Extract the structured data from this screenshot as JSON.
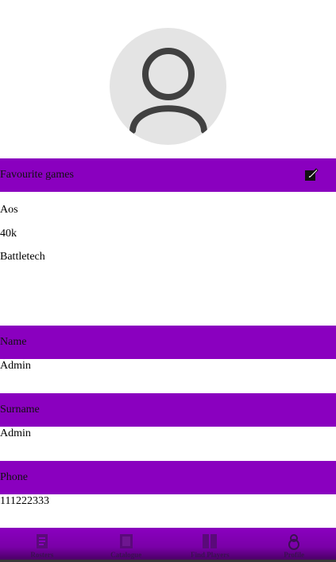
{
  "avatar": {
    "icon": "user-avatar-icon"
  },
  "favourites": {
    "header": "Favourite games",
    "edit_icon": "edit-icon",
    "games": [
      "Aos",
      "40k",
      "Battletech"
    ]
  },
  "fields": [
    {
      "label": "Name",
      "value": "Admin"
    },
    {
      "label": "Surname",
      "value": "Admin"
    },
    {
      "label": "Phone",
      "value": "111222333"
    }
  ],
  "nav": [
    {
      "label": "Rosters",
      "icon": "roster-icon"
    },
    {
      "label": "Catalogue",
      "icon": "catalogue-icon"
    },
    {
      "label": "Find Players",
      "icon": "book-icon"
    },
    {
      "label": "Profile",
      "icon": "profile-icon"
    }
  ],
  "colors": {
    "accent": "#8a00bf",
    "avatar_bg": "#e4e4e4",
    "avatar_fg": "#404040"
  }
}
